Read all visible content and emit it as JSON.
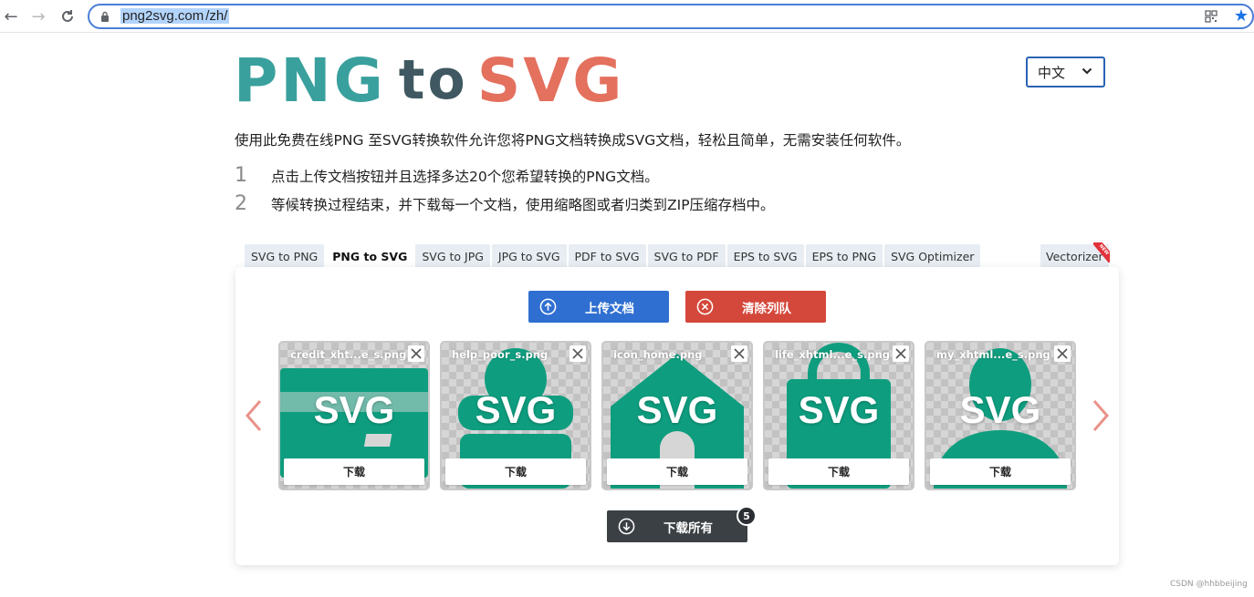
{
  "browser": {
    "url_domain": "png2svg.com",
    "url_path": "/zh/"
  },
  "logo": {
    "part1": "PNG",
    "part2": "to",
    "part3": "SVG"
  },
  "lang": {
    "selected": "中文"
  },
  "intro": "使用此免费在线PNG 至SVG转换软件允许您将PNG文档转换成SVG文档，轻松且简单，无需安装任何软件。",
  "steps": [
    {
      "num": "1",
      "text": "点击上传文档按钮并且选择多达20个您希望转换的PNG文档。"
    },
    {
      "num": "2",
      "text": "等候转换过程结束，并下载每一个文档，使用缩略图或者归类到ZIP压缩存档中。"
    }
  ],
  "tabs": [
    {
      "label": "SVG to PNG",
      "active": false
    },
    {
      "label": "PNG to SVG",
      "active": true
    },
    {
      "label": "SVG to JPG",
      "active": false
    },
    {
      "label": "JPG to SVG",
      "active": false
    },
    {
      "label": "PDF to SVG",
      "active": false
    },
    {
      "label": "SVG to PDF",
      "active": false
    },
    {
      "label": "EPS to SVG",
      "active": false
    },
    {
      "label": "EPS to PNG",
      "active": false
    },
    {
      "label": "SVG Optimizer",
      "active": false
    }
  ],
  "vectorizer": {
    "label": "Vectorizer",
    "badge": "NEW"
  },
  "buttons": {
    "upload": "上传文档",
    "clear": "清除列队",
    "download_all": "下载所有"
  },
  "file_count": "5",
  "files": [
    {
      "name": "credit_xht...e_s.png",
      "preview": "SVG",
      "download": "下载",
      "icon": "credit-card-icon"
    },
    {
      "name": "help_poor_s.png",
      "preview": "SVG",
      "download": "下载",
      "icon": "handshake-icon"
    },
    {
      "name": "icon_home.png",
      "preview": "SVG",
      "download": "下载",
      "icon": "home-icon"
    },
    {
      "name": "life_xhtml...e_s.png",
      "preview": "SVG",
      "download": "下载",
      "icon": "shopping-bag-icon"
    },
    {
      "name": "my_xhtml...e_s.png",
      "preview": "SVG",
      "download": "下载",
      "icon": "user-icon"
    }
  ],
  "colors": {
    "teal": "#3aa09d",
    "dark": "#3f5862",
    "coral": "#e4705e",
    "icon_green": "#0e9e7f",
    "upload": "#2f6fd1",
    "clear": "#d4483b"
  },
  "watermark": "CSDN @hhbbeijing"
}
